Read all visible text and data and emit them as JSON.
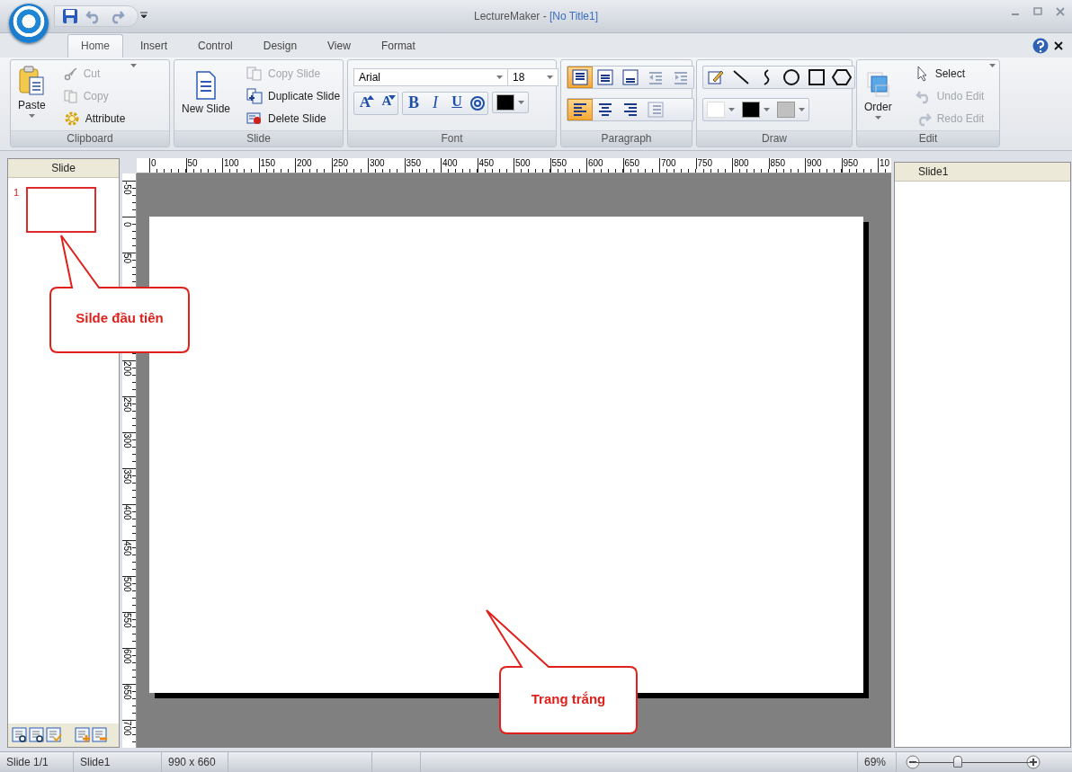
{
  "window": {
    "app_name": "LectureMaker - ",
    "document_name": "[No Title1]"
  },
  "tabs": [
    {
      "label": "Home",
      "selected": true
    },
    {
      "label": "Insert",
      "selected": false
    },
    {
      "label": "Control",
      "selected": false
    },
    {
      "label": "Design",
      "selected": false
    },
    {
      "label": "View",
      "selected": false
    },
    {
      "label": "Format",
      "selected": false
    }
  ],
  "ribbon": {
    "clipboard": {
      "label": "Clipboard",
      "paste": "Paste",
      "items": [
        {
          "kind": "cut",
          "label": "Cut",
          "disabled": true
        },
        {
          "kind": "copy",
          "label": "Copy",
          "disabled": true
        },
        {
          "kind": "attribute",
          "label": "Attribute",
          "disabled": false
        }
      ]
    },
    "slide": {
      "label": "Slide",
      "new_slide": "New Slide",
      "items": [
        {
          "kind": "copy-slide",
          "label": "Copy Slide",
          "disabled": true
        },
        {
          "kind": "duplicate",
          "label": "Duplicate Slide",
          "disabled": false
        },
        {
          "kind": "delete",
          "label": "Delete Slide",
          "disabled": false
        }
      ]
    },
    "font": {
      "label": "Font",
      "family": "Arial",
      "size": "18",
      "styles": [
        {
          "kind": "grow",
          "label": "A"
        },
        {
          "kind": "shrink",
          "label": "A"
        },
        {
          "kind": "bold",
          "label": "B"
        },
        {
          "kind": "italic",
          "label": "I"
        },
        {
          "kind": "underline",
          "label": "U"
        }
      ],
      "color": "#000000"
    },
    "paragraph": {
      "label": "Paragraph",
      "vertical": [
        {
          "kind": "top",
          "selected": true,
          "disabled": false
        },
        {
          "kind": "middle",
          "selected": false,
          "disabled": false
        },
        {
          "kind": "bottom",
          "selected": false,
          "disabled": false
        },
        {
          "kind": "outdent",
          "selected": false,
          "disabled": true
        },
        {
          "kind": "indent",
          "selected": false,
          "disabled": true
        }
      ],
      "horizontal": [
        {
          "kind": "left",
          "selected": true,
          "disabled": false
        },
        {
          "kind": "center",
          "selected": false,
          "disabled": false
        },
        {
          "kind": "right",
          "selected": false,
          "disabled": false
        },
        {
          "kind": "list",
          "selected": false,
          "disabled": true
        }
      ]
    },
    "draw": {
      "label": "Draw",
      "colors": [
        {
          "kind": "fill",
          "color": "#ffffff"
        },
        {
          "kind": "line",
          "color": "#000000"
        },
        {
          "kind": "shadow",
          "color": "#c0c0c0"
        }
      ]
    },
    "edit": {
      "label": "Edit",
      "order": "Order",
      "items": [
        {
          "kind": "select",
          "label": "Select",
          "disabled": false
        },
        {
          "kind": "undo",
          "label": "Undo Edit",
          "disabled": true
        },
        {
          "kind": "redo",
          "label": "Redo Edit",
          "disabled": true
        }
      ]
    }
  },
  "slide_panel": {
    "title": "Slide",
    "slides": [
      {
        "number": "1",
        "selected": true
      }
    ]
  },
  "rulers": {
    "horizontal": [
      "0",
      "50",
      "100",
      "150",
      "200",
      "250",
      "300",
      "350",
      "400",
      "450",
      "500",
      "550",
      "600",
      "650",
      "700",
      "750",
      "800",
      "850",
      "900",
      "950",
      "10"
    ],
    "vertical": [
      "-50",
      "0",
      "50",
      "200",
      "250",
      "300",
      "350",
      "400",
      "450",
      "500",
      "550",
      "600",
      "650",
      "700"
    ]
  },
  "object_panel": {
    "title": "Slide1"
  },
  "annotations": [
    {
      "text": "Silde đầu tiên"
    },
    {
      "text": "Trang trắng"
    }
  ],
  "status_bar": {
    "segments": [
      "Slide 1/1",
      "Slide1",
      "990 x 660"
    ],
    "zoom": "69%",
    "zoom_slider": {
      "level": 0.36
    }
  }
}
